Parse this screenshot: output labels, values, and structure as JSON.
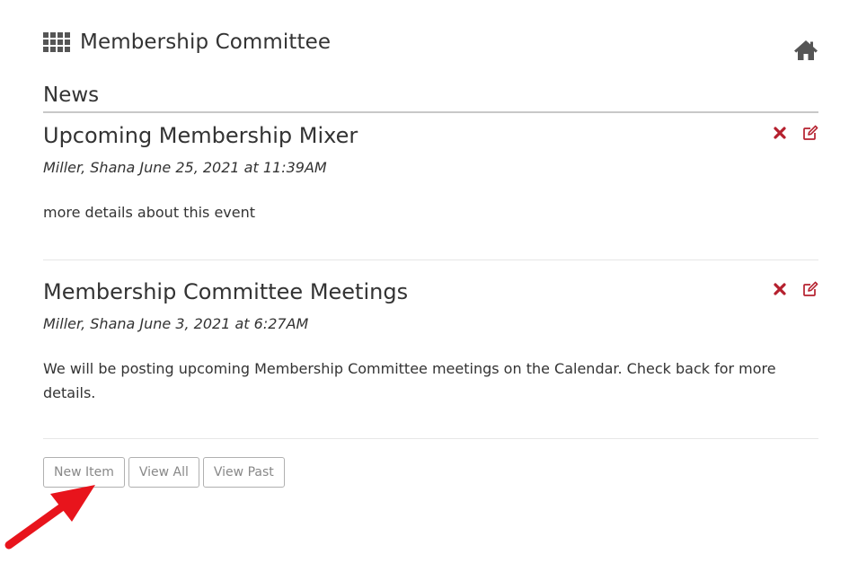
{
  "header": {
    "title": "Membership Committee",
    "grid_icon": "grid-apps-icon",
    "home_icon": "home-icon"
  },
  "section": {
    "title": "News"
  },
  "news": [
    {
      "title": "Upcoming Membership Mixer",
      "meta": "Miller, Shana June 25, 2021 at 11:39AM",
      "body": "more details about this event"
    },
    {
      "title": "Membership Committee Meetings",
      "meta": "Miller, Shana June 3, 2021 at 6:27AM",
      "body": "We will be posting upcoming Membership Committee meetings on the Calendar. Check back for more details."
    }
  ],
  "buttons": {
    "new_item": "New Item",
    "view_all": "View All",
    "view_past": "View Past"
  },
  "colors": {
    "delete": "#b5202e",
    "edit": "#b5202e",
    "annotation_arrow": "#e8141c",
    "text": "#333333"
  }
}
